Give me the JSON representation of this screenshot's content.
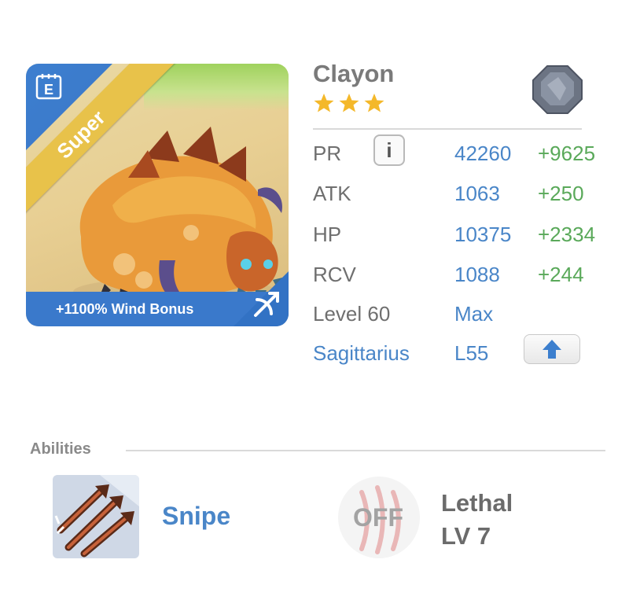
{
  "card": {
    "rarity": "Super",
    "bonus": "+1100% Wind Bonus",
    "corner_icon": "edit-note-icon",
    "element_icon": "bow-arrow-icon"
  },
  "monster": {
    "name": "Clayon",
    "stars": 3,
    "type_icon": "rock-icon"
  },
  "stats": {
    "pr": {
      "label": "PR",
      "value": "42260",
      "bonus": "+9625"
    },
    "atk": {
      "label": "ATK",
      "value": "1063",
      "bonus": "+250"
    },
    "hp": {
      "label": "HP",
      "value": "10375",
      "bonus": "+2334"
    },
    "rcv": {
      "label": "RCV",
      "value": "1088",
      "bonus": "+244"
    },
    "level": {
      "label": "Level 60",
      "value": "Max"
    },
    "zodiac": {
      "label": "Sagittarius",
      "value": "L55"
    }
  },
  "abilities": {
    "header": "Abilities",
    "items": [
      {
        "name": "Snipe",
        "icon": "snipe-arrows-icon"
      },
      {
        "name": "Lethal",
        "level": "LV 7",
        "status": "OFF",
        "icon": "claw-marks-icon"
      }
    ]
  },
  "colors": {
    "blue": "#4a86c8",
    "green": "#5aa95a",
    "gold": "#f4b82a",
    "card_blue": "#3a79cb"
  }
}
